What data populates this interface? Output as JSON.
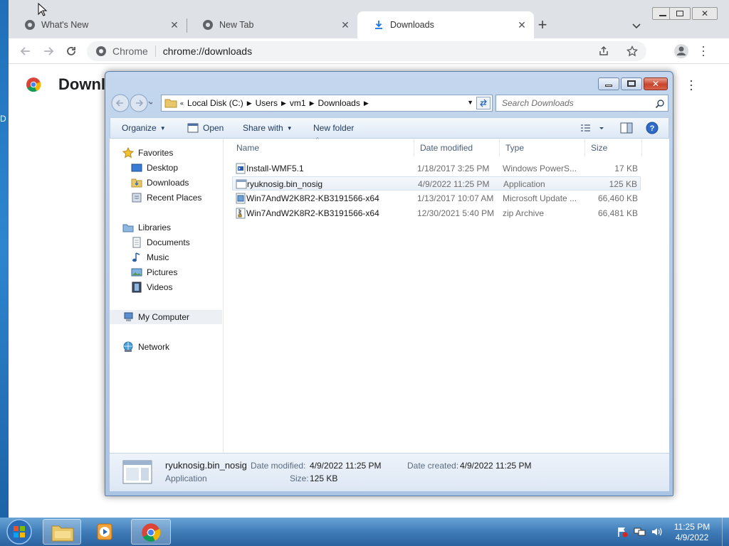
{
  "browser": {
    "tabs": [
      {
        "label": "What's New"
      },
      {
        "label": "New Tab"
      },
      {
        "label": "Downloads"
      }
    ],
    "omnibox": {
      "site": "Chrome",
      "url": "chrome://downloads"
    },
    "page_title": "Downloads"
  },
  "desktop_edge": {
    "left_text": "D"
  },
  "explorer": {
    "breadcrumb": [
      "Local Disk (C:)",
      "Users",
      "vm1",
      "Downloads"
    ],
    "search_placeholder": "Search Downloads",
    "commands": {
      "organize": "Organize",
      "open": "Open",
      "share_with": "Share with",
      "new_folder": "New folder"
    },
    "nav": {
      "favorites": "Favorites",
      "favorites_items": [
        "Desktop",
        "Downloads",
        "Recent Places"
      ],
      "libraries": "Libraries",
      "libraries_items": [
        "Documents",
        "Music",
        "Pictures",
        "Videos"
      ],
      "computer": "My Computer",
      "network": "Network"
    },
    "columns": {
      "name": "Name",
      "date": "Date modified",
      "type": "Type",
      "size": "Size"
    },
    "files": [
      {
        "name": "Install-WMF5.1",
        "date": "1/18/2017 3:25 PM",
        "type": "Windows PowerS...",
        "size": "17 KB",
        "icon": "powershell-script-icon"
      },
      {
        "name": "ryuknosig.bin_nosig",
        "date": "4/9/2022 11:25 PM",
        "type": "Application",
        "size": "125 KB",
        "icon": "application-icon",
        "selected": true
      },
      {
        "name": "Win7AndW2K8R2-KB3191566-x64",
        "date": "1/13/2017 10:07 AM",
        "type": "Microsoft Update ...",
        "size": "66,460 KB",
        "icon": "msu-icon"
      },
      {
        "name": "Win7AndW2K8R2-KB3191566-x64",
        "date": "12/30/2021 5:40 PM",
        "type": "zip Archive",
        "size": "66,481 KB",
        "icon": "zip-icon"
      }
    ],
    "details": {
      "name": "ryuknosig.bin_nosig",
      "kind": "Application",
      "date_modified_label": "Date modified:",
      "date_modified": "4/9/2022 11:25 PM",
      "size_label": "Size:",
      "size": "125 KB",
      "date_created_label": "Date created:",
      "date_created": "4/9/2022 11:25 PM"
    }
  },
  "taskbar": {
    "clock_time": "11:25 PM",
    "clock_date": "4/9/2022"
  }
}
